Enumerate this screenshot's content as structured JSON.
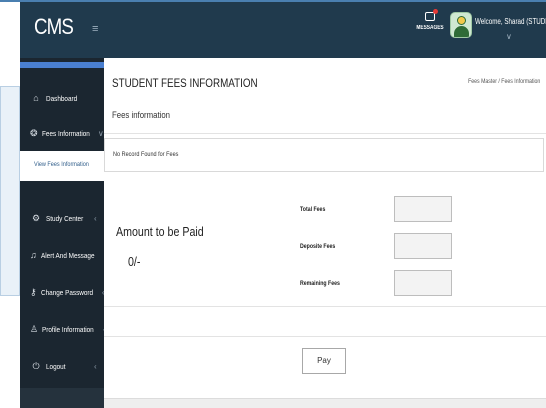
{
  "header": {
    "brand": "CMS",
    "menu_toggle": "≡",
    "messages_label": "MESSAGES",
    "welcome": "Welcome, Sharad (STUDENT)",
    "user_chevron": "∨"
  },
  "sidebar": {
    "items": [
      {
        "label": "Dashboard",
        "icon": "⌂",
        "chevron": ""
      },
      {
        "label": "Fees Information",
        "icon": "❂",
        "chevron": "∨"
      },
      {
        "label": "Study Center",
        "icon": "⚙",
        "chevron": "‹"
      },
      {
        "label": "Alert And Message",
        "icon": "♫",
        "chevron": "‹"
      },
      {
        "label": "Change Password",
        "icon": "⚷",
        "chevron": "‹"
      },
      {
        "label": "Profile Information",
        "icon": "♙",
        "chevron": "‹"
      },
      {
        "label": "Logout",
        "icon": "⏻",
        "chevron": "‹"
      }
    ],
    "sub_link": "View Fees Information"
  },
  "main": {
    "title": "STUDENT FEES INFORMATION",
    "breadcrumb": "Fees Master  /  Fees Information",
    "section": "Fees information",
    "no_record": "No Record Found for Fees",
    "amount_label": "Amount to be Paid",
    "amount_value": "0/-",
    "fees": {
      "total_label": "Total Fees",
      "deposit_label": "Deposite Fees",
      "remaining_label": "Remaining Fees",
      "total_value": "",
      "deposit_value": "",
      "remaining_value": ""
    },
    "pay_button": "Pay"
  },
  "colors": {
    "topbar": "#203a4d",
    "sidebar": "#1b2630",
    "accent": "#4a7fd0",
    "link": "#2f5d8a",
    "notification": "#e53935"
  }
}
